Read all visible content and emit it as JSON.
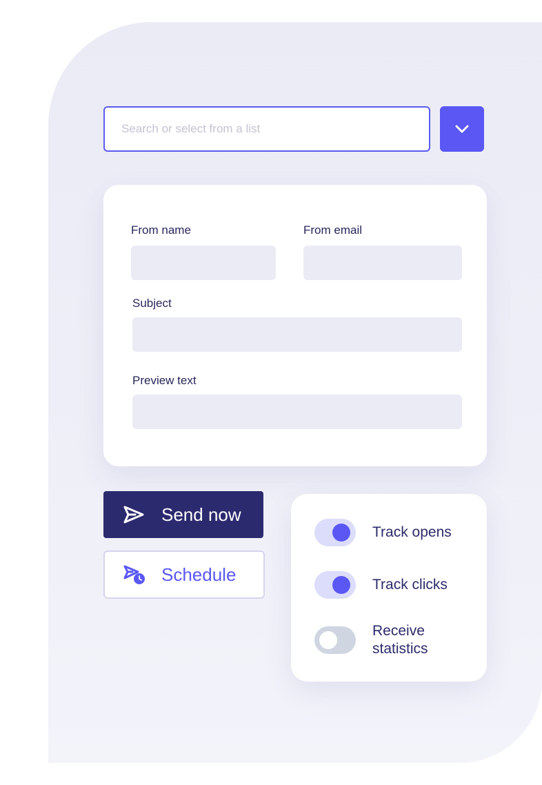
{
  "search": {
    "placeholder": "Search or select from a list",
    "value": ""
  },
  "dropdown": {
    "icon": "chevron-down-icon"
  },
  "form": {
    "from_name_label": "From name",
    "from_name_value": "",
    "from_email_label": "From email",
    "from_email_value": "",
    "subject_label": "Subject",
    "subject_value": "",
    "preview_label": "Preview text",
    "preview_value": ""
  },
  "actions": {
    "send_label": "Send now",
    "send_icon": "paper-plane-icon",
    "schedule_label": "Schedule",
    "schedule_icon": "schedule-send-icon"
  },
  "toggles": [
    {
      "label": "Track opens",
      "on": true
    },
    {
      "label": "Track clicks",
      "on": true
    },
    {
      "label": "Receive statistics",
      "on": false
    }
  ],
  "colors": {
    "accent": "#5a57f5",
    "primary_dark": "#2c2a6e",
    "field_bg": "#ebebf5",
    "panel_bg": "#ededf7",
    "toggle_off": "#cfd6e2"
  }
}
